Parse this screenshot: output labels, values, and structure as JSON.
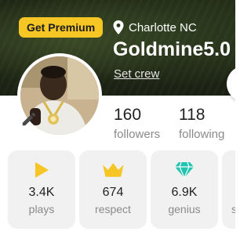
{
  "header": {
    "premium_label": "Get Premium",
    "location": "Charlotte NC",
    "username": "Goldmine5.0",
    "set_crew_label": "Set crew"
  },
  "stats": {
    "followers_count": "160",
    "followers_label": "followers",
    "following_count": "118",
    "following_label": "following"
  },
  "cards": [
    {
      "value": "3.4K",
      "label": "plays",
      "icon": "play-icon",
      "icon_color": "#f6c625"
    },
    {
      "value": "674",
      "label": "respect",
      "icon": "crown-icon",
      "icon_color": "#f6c625"
    },
    {
      "value": "6.9K",
      "label": "genius",
      "icon": "diamond-icon",
      "icon_color": "#22c3b0"
    },
    {
      "value": "",
      "label": "s",
      "icon": "",
      "icon_color": ""
    }
  ],
  "colors": {
    "premium_badge": "#f6c625",
    "card_background": "#f1f1f1",
    "muted_text": "#8a8a8a"
  }
}
